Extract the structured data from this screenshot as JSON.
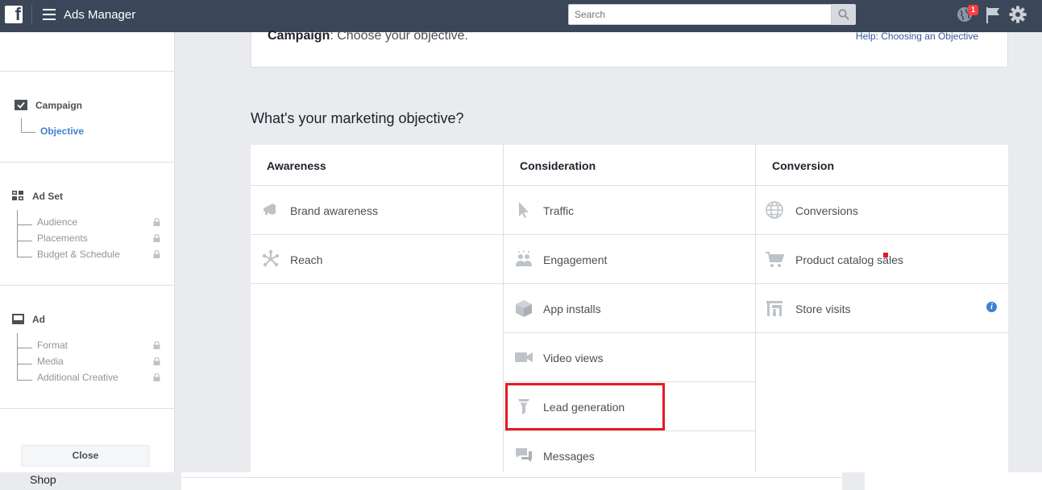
{
  "topbar": {
    "logo_letter": "f",
    "app_title": "Ads Manager",
    "search_placeholder": "Search",
    "notification_count": "1"
  },
  "sidebar": {
    "campaign": {
      "label": "Campaign",
      "active_item": "Objective"
    },
    "adset": {
      "label": "Ad Set",
      "items": [
        "Audience",
        "Placements",
        "Budget & Schedule"
      ]
    },
    "ad": {
      "label": "Ad",
      "items": [
        "Format",
        "Media",
        "Additional Creative"
      ]
    },
    "close_label": "Close"
  },
  "header_card": {
    "bold": "Campaign",
    "rest": ": Choose your objective.",
    "help_link": "Help: Choosing an Objective"
  },
  "heading": "What's your marketing objective?",
  "columns": [
    {
      "title": "Awareness",
      "options": [
        "Brand awareness",
        "Reach"
      ]
    },
    {
      "title": "Consideration",
      "options": [
        "Traffic",
        "Engagement",
        "App installs",
        "Video views",
        "Lead generation",
        "Messages"
      ]
    },
    {
      "title": "Conversion",
      "options": [
        "Conversions",
        "Product catalog sales",
        "Store visits"
      ]
    }
  ],
  "highlighted_option": "Lead generation",
  "footer": {
    "shop_label": "Shop"
  },
  "colors": {
    "topbar": "#3b4758",
    "accent": "#4080d0",
    "highlight": "#e31b23",
    "background": "#e9ebee"
  }
}
